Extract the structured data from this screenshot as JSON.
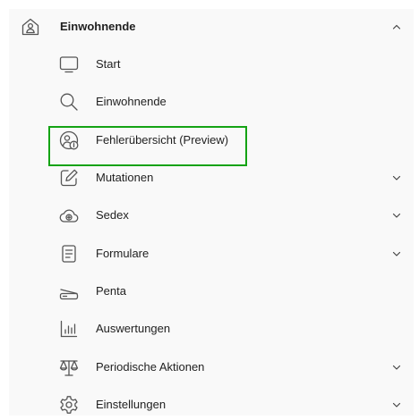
{
  "nav": {
    "section": {
      "label": "Einwohnende",
      "icon": "house-person-icon",
      "expanded": true
    },
    "items": [
      {
        "label": "Start",
        "icon": "monitor-icon",
        "has_children": false
      },
      {
        "label": "Einwohnende",
        "icon": "search-icon",
        "has_children": false
      },
      {
        "label": "Fehlerübersicht (Preview)",
        "icon": "person-info-icon",
        "has_children": false,
        "highlighted": true
      },
      {
        "label": "Mutationen",
        "icon": "edit-icon",
        "has_children": true
      },
      {
        "label": "Sedex",
        "icon": "cloud-add-icon",
        "has_children": true
      },
      {
        "label": "Formulare",
        "icon": "document-icon",
        "has_children": true
      },
      {
        "label": "Penta",
        "icon": "scanner-icon",
        "has_children": false
      },
      {
        "label": "Auswertungen",
        "icon": "bar-chart-icon",
        "has_children": false
      },
      {
        "label": "Periodische Aktionen",
        "icon": "scale-icon",
        "has_children": true
      },
      {
        "label": "Einstellungen",
        "icon": "gear-icon",
        "has_children": true
      }
    ],
    "highlight_color": "#14a314",
    "icon_color": "#555555"
  }
}
